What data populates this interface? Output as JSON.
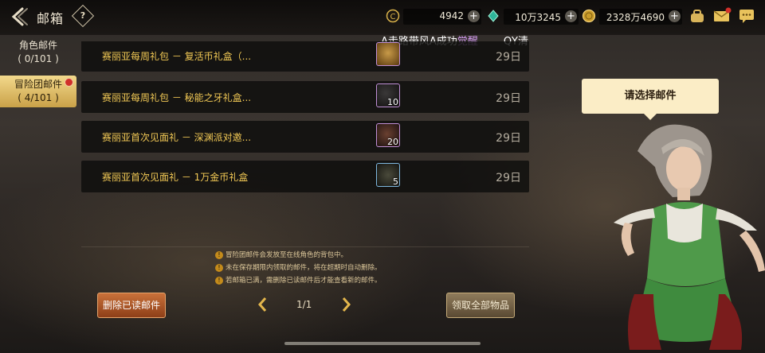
{
  "header": {
    "title": "邮箱",
    "help_glyph": "?"
  },
  "currencies": [
    {
      "name": "coin-currency",
      "value": "4942"
    },
    {
      "name": "gem-currency",
      "value": "10万3245"
    },
    {
      "name": "gold-currency",
      "value": "2328万4690"
    }
  ],
  "ticker": {
    "prefix": "A走路带风A成功",
    "highlight": "觉醒",
    "suffix": "QY清"
  },
  "tabs": [
    {
      "label": "角色邮件",
      "count": "( 0/101 )"
    },
    {
      "label": "冒险团邮件",
      "count": "( 4/101 )"
    }
  ],
  "mails": [
    {
      "name": "赛丽亚每周礼包 － 复活币礼盒（...",
      "count": "",
      "date": "29日"
    },
    {
      "name": "赛丽亚每周礼包 － 秘能之牙礼盒...",
      "count": "10",
      "date": "29日"
    },
    {
      "name": "赛丽亚首次见面礼 － 深渊派对邀...",
      "count": "20",
      "date": "29日"
    },
    {
      "name": "赛丽亚首次见面礼 － 1万金币礼盒",
      "count": "5",
      "date": "29日"
    }
  ],
  "notes": [
    "冒险团邮件会发放至在线角色的背包中。",
    "未在保存期限内领取的邮件，将在超期时自动删除。",
    "若邮箱已满，需删除已读邮件后才能查看新的邮件。"
  ],
  "notes_glyph": "!",
  "buttons": {
    "delete_read": "删除已读邮件",
    "claim_all": "领取全部物品"
  },
  "pager": {
    "text": "1/1"
  },
  "bubble": {
    "text": "请选择邮件"
  },
  "colors": {
    "accent": "#f2c955",
    "tab_active": "#e6c66c",
    "highlight": "#d49cf0"
  }
}
